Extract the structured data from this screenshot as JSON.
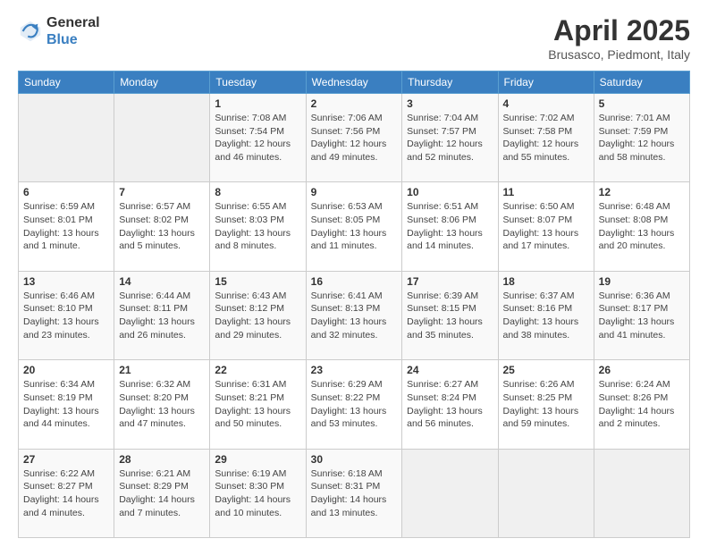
{
  "header": {
    "logo_line1": "General",
    "logo_line2": "Blue",
    "month_title": "April 2025",
    "location": "Brusasco, Piedmont, Italy"
  },
  "weekdays": [
    "Sunday",
    "Monday",
    "Tuesday",
    "Wednesday",
    "Thursday",
    "Friday",
    "Saturday"
  ],
  "weeks": [
    [
      {
        "day": "",
        "info": ""
      },
      {
        "day": "",
        "info": ""
      },
      {
        "day": "1",
        "info": "Sunrise: 7:08 AM\nSunset: 7:54 PM\nDaylight: 12 hours and 46 minutes."
      },
      {
        "day": "2",
        "info": "Sunrise: 7:06 AM\nSunset: 7:56 PM\nDaylight: 12 hours and 49 minutes."
      },
      {
        "day": "3",
        "info": "Sunrise: 7:04 AM\nSunset: 7:57 PM\nDaylight: 12 hours and 52 minutes."
      },
      {
        "day": "4",
        "info": "Sunrise: 7:02 AM\nSunset: 7:58 PM\nDaylight: 12 hours and 55 minutes."
      },
      {
        "day": "5",
        "info": "Sunrise: 7:01 AM\nSunset: 7:59 PM\nDaylight: 12 hours and 58 minutes."
      }
    ],
    [
      {
        "day": "6",
        "info": "Sunrise: 6:59 AM\nSunset: 8:01 PM\nDaylight: 13 hours and 1 minute."
      },
      {
        "day": "7",
        "info": "Sunrise: 6:57 AM\nSunset: 8:02 PM\nDaylight: 13 hours and 5 minutes."
      },
      {
        "day": "8",
        "info": "Sunrise: 6:55 AM\nSunset: 8:03 PM\nDaylight: 13 hours and 8 minutes."
      },
      {
        "day": "9",
        "info": "Sunrise: 6:53 AM\nSunset: 8:05 PM\nDaylight: 13 hours and 11 minutes."
      },
      {
        "day": "10",
        "info": "Sunrise: 6:51 AM\nSunset: 8:06 PM\nDaylight: 13 hours and 14 minutes."
      },
      {
        "day": "11",
        "info": "Sunrise: 6:50 AM\nSunset: 8:07 PM\nDaylight: 13 hours and 17 minutes."
      },
      {
        "day": "12",
        "info": "Sunrise: 6:48 AM\nSunset: 8:08 PM\nDaylight: 13 hours and 20 minutes."
      }
    ],
    [
      {
        "day": "13",
        "info": "Sunrise: 6:46 AM\nSunset: 8:10 PM\nDaylight: 13 hours and 23 minutes."
      },
      {
        "day": "14",
        "info": "Sunrise: 6:44 AM\nSunset: 8:11 PM\nDaylight: 13 hours and 26 minutes."
      },
      {
        "day": "15",
        "info": "Sunrise: 6:43 AM\nSunset: 8:12 PM\nDaylight: 13 hours and 29 minutes."
      },
      {
        "day": "16",
        "info": "Sunrise: 6:41 AM\nSunset: 8:13 PM\nDaylight: 13 hours and 32 minutes."
      },
      {
        "day": "17",
        "info": "Sunrise: 6:39 AM\nSunset: 8:15 PM\nDaylight: 13 hours and 35 minutes."
      },
      {
        "day": "18",
        "info": "Sunrise: 6:37 AM\nSunset: 8:16 PM\nDaylight: 13 hours and 38 minutes."
      },
      {
        "day": "19",
        "info": "Sunrise: 6:36 AM\nSunset: 8:17 PM\nDaylight: 13 hours and 41 minutes."
      }
    ],
    [
      {
        "day": "20",
        "info": "Sunrise: 6:34 AM\nSunset: 8:19 PM\nDaylight: 13 hours and 44 minutes."
      },
      {
        "day": "21",
        "info": "Sunrise: 6:32 AM\nSunset: 8:20 PM\nDaylight: 13 hours and 47 minutes."
      },
      {
        "day": "22",
        "info": "Sunrise: 6:31 AM\nSunset: 8:21 PM\nDaylight: 13 hours and 50 minutes."
      },
      {
        "day": "23",
        "info": "Sunrise: 6:29 AM\nSunset: 8:22 PM\nDaylight: 13 hours and 53 minutes."
      },
      {
        "day": "24",
        "info": "Sunrise: 6:27 AM\nSunset: 8:24 PM\nDaylight: 13 hours and 56 minutes."
      },
      {
        "day": "25",
        "info": "Sunrise: 6:26 AM\nSunset: 8:25 PM\nDaylight: 13 hours and 59 minutes."
      },
      {
        "day": "26",
        "info": "Sunrise: 6:24 AM\nSunset: 8:26 PM\nDaylight: 14 hours and 2 minutes."
      }
    ],
    [
      {
        "day": "27",
        "info": "Sunrise: 6:22 AM\nSunset: 8:27 PM\nDaylight: 14 hours and 4 minutes."
      },
      {
        "day": "28",
        "info": "Sunrise: 6:21 AM\nSunset: 8:29 PM\nDaylight: 14 hours and 7 minutes."
      },
      {
        "day": "29",
        "info": "Sunrise: 6:19 AM\nSunset: 8:30 PM\nDaylight: 14 hours and 10 minutes."
      },
      {
        "day": "30",
        "info": "Sunrise: 6:18 AM\nSunset: 8:31 PM\nDaylight: 14 hours and 13 minutes."
      },
      {
        "day": "",
        "info": ""
      },
      {
        "day": "",
        "info": ""
      },
      {
        "day": "",
        "info": ""
      }
    ]
  ]
}
